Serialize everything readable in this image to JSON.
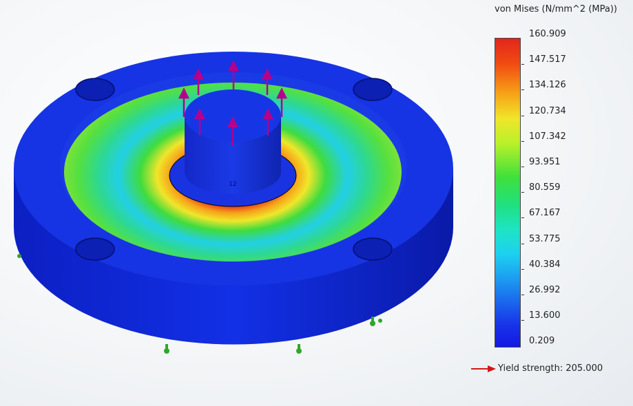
{
  "legend": {
    "title": "von Mises (N/mm^2 (MPa))",
    "ticks": [
      "160.909",
      "147.517",
      "134.126",
      "120.734",
      "107.342",
      "93.951",
      "80.559",
      "67.167",
      "53.775",
      "40.384",
      "26.992",
      "13.600",
      "0.209"
    ],
    "yield_label": "Yield strength: 205.000"
  },
  "model": {
    "label": "12"
  },
  "colors": {
    "max": "#e1261c",
    "mid": "#3fe03b",
    "min": "#1418e4",
    "load_arrow": "#b5008c",
    "fixture": "#2ea82a",
    "yield_arrow": "#d61616"
  }
}
